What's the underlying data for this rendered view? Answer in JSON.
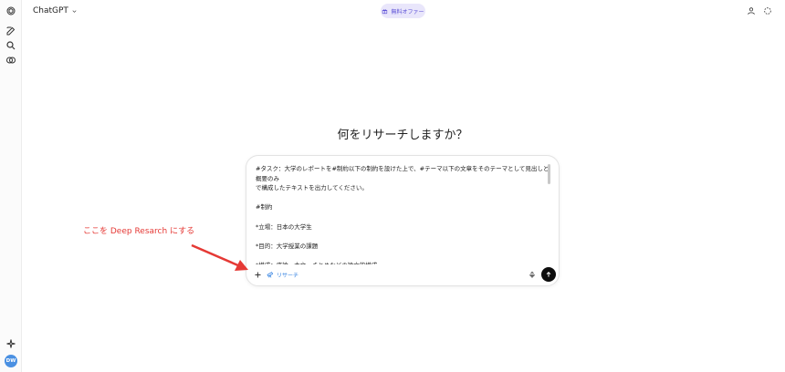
{
  "header": {
    "brand": "ChatGPT",
    "offer_label": "無料オファー"
  },
  "rail": {
    "icons": [
      "chatgpt-logo-icon",
      "new-chat-icon",
      "search-icon",
      "library-icon",
      "sparkle-icon"
    ],
    "avatar_initials": "DW"
  },
  "main": {
    "heading": "何をリサーチしますか？"
  },
  "composer": {
    "lines": [
      "#タスク：大学のレポートを#制約以下の制約を設けた上で、#テーマ以下の文章をそのテーマとして見出しと概要のみ",
      "で構成したテキストを出力してください。",
      "",
      "#制約",
      "",
      "*立場：日本の大学生",
      "",
      "*目的：大学授業の課題",
      "",
      "*構成：序論、本文、まとめなどの論文的構成"
    ],
    "research_label": "リサーチ"
  },
  "annotation": {
    "text": "ここを Deep Resarch にする",
    "color": "#e53935"
  },
  "colors": {
    "accent": "#2f7fe0",
    "offer_bg": "#e9e6fb",
    "offer_text": "#5b4fd6",
    "send_bg": "#0d0d0d"
  }
}
